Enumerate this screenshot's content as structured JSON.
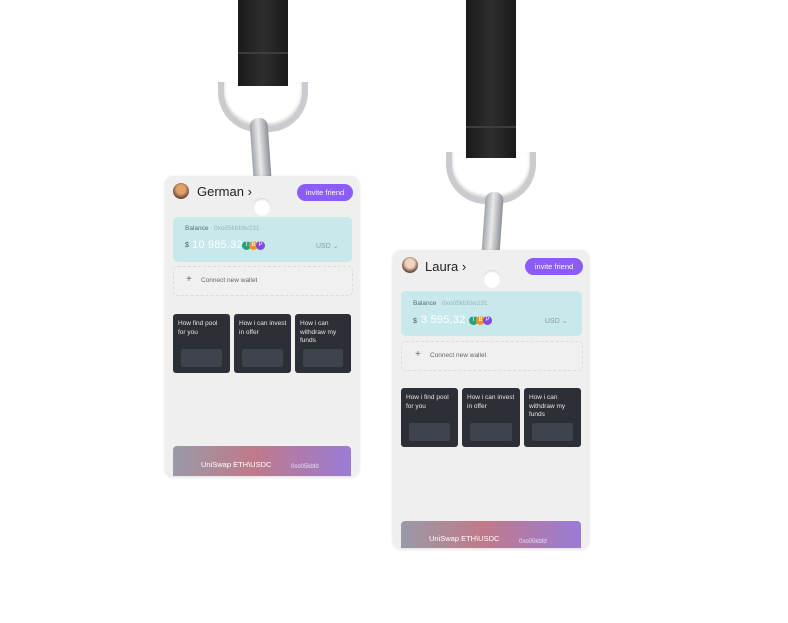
{
  "badges": [
    {
      "user_name": "German",
      "chevron": "›",
      "invite_label": "invite friend",
      "balance_label": "Balance",
      "wallet_address": "0xo05kbfdw231",
      "currency_symbol": "$",
      "balance_amount": "10 985.32",
      "currency_select": "USD",
      "connect_label": "Connect new wallet",
      "tiles": [
        "How find pool for you",
        "How i can invest in offer",
        "How i can withdraw my funds"
      ],
      "pool_title": "UniSwap ETH\\USDC",
      "pool_address": "0xo05kbfd"
    },
    {
      "user_name": "Laura",
      "chevron": "›",
      "invite_label": "invite friend",
      "balance_label": "Balance",
      "wallet_address": "0xo05kbfdw231",
      "currency_symbol": "$",
      "balance_amount": "3 595.32",
      "currency_select": "USD",
      "connect_label": "Connect new wallet",
      "tiles": [
        "How i find pool for you",
        "How i can invest in offer",
        "How i can withdraw my funds"
      ],
      "pool_title": "UniSwap ETH\\USDC",
      "pool_address": "0xo05kbfd"
    }
  ],
  "icons": {
    "avatar": "user-avatar",
    "plus": "plus-icon",
    "tokens": [
      "tether-token-icon",
      "bitcoin-token-icon",
      "polygon-token-icon"
    ],
    "dropdown": "chevron-down-icon"
  },
  "colors": {
    "accent": "#8b5cf6",
    "balance_bg": "#c7e9ec",
    "card_bg": "#efefef",
    "strap": "#1f1f1f"
  }
}
